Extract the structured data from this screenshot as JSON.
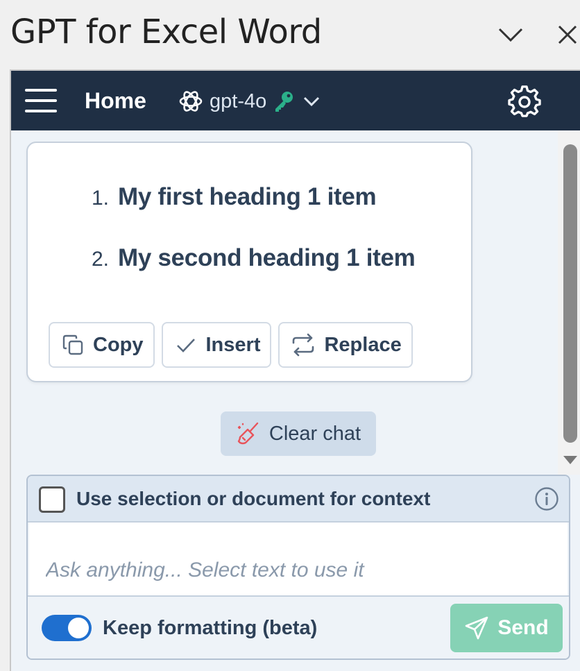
{
  "pane": {
    "title": "GPT for Excel Word"
  },
  "nav": {
    "home_label": "Home",
    "model_name": "gpt-4o",
    "icons": [
      "menu-icon",
      "openai-icon",
      "key-icon",
      "chevron-down-icon",
      "gear-icon"
    ],
    "colors": {
      "bar": "#1f2f44",
      "key": "#2bb08a"
    }
  },
  "message": {
    "items": [
      {
        "num": "1.",
        "text": "My first heading 1 item"
      },
      {
        "num": "2.",
        "text": "My second heading 1 item"
      }
    ],
    "actions": {
      "copy_label": "Copy",
      "insert_label": "Insert",
      "replace_label": "Replace"
    }
  },
  "clear_chat": {
    "label": "Clear chat",
    "icon": "broom-icon",
    "icon_color": "#e8545b"
  },
  "composer": {
    "context_label": "Use selection or document for context",
    "context_checked": false,
    "placeholder": "Ask anything... Select text to use it",
    "value": "",
    "keep_formatting_label": "Keep formatting (beta)",
    "keep_formatting_on": true,
    "send_label": "Send",
    "colors": {
      "toggle": "#1f6fcf",
      "send": "#86d2b5"
    }
  }
}
